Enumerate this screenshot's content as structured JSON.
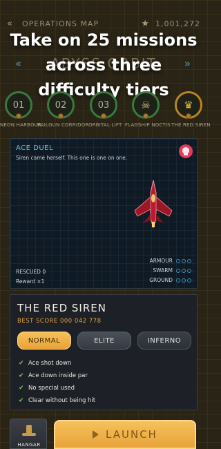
{
  "header": {
    "title": "OPERATIONS MAP",
    "score": "1,001,272",
    "region": "ABYSS ORBIT"
  },
  "promo": {
    "line1": "Take on 25 missions",
    "line2": "across three",
    "line3": "difficulty tiers"
  },
  "missions": [
    {
      "number": "01",
      "label": "NEON HARBOUR"
    },
    {
      "number": "02",
      "label": "RAILGUN CORRIDOR"
    },
    {
      "number": "03",
      "label": "ORBITAL LIFT"
    },
    {
      "number": "",
      "label": "FLAGSHIP NOCTIS",
      "icon": "skull-icon"
    },
    {
      "number": "",
      "label": "THE RED SIREN",
      "icon": "trophy-icon"
    }
  ],
  "mission_detail": {
    "name": "ACE DUEL",
    "description": "Siren came herself. This one is one on one.",
    "rescued": "RESCUED 0",
    "reward": "Reward ×1",
    "threats": [
      {
        "label": "ARMOUR",
        "level": 0,
        "max": 3
      },
      {
        "label": "SWARM",
        "level": 0,
        "max": 3
      },
      {
        "label": "GROUND",
        "level": 0,
        "max": 3
      }
    ]
  },
  "card": {
    "title": "THE RED SIREN",
    "best_score": "BEST SCORE  000 042 778",
    "difficulties": [
      "NORMAL",
      "ELITE",
      "INFERNO"
    ],
    "selected_difficulty": "NORMAL",
    "objectives": [
      "Ace shot down",
      "Ace down inside par",
      "No special used",
      "Clear without being hit"
    ]
  },
  "actions": {
    "hangar_label": "HANGAR",
    "launch_label": "LAUNCH"
  },
  "colors": {
    "accent_gold": "#f0b24a",
    "accent_cyan": "#5ec3e6",
    "check_green": "#6fcf5a",
    "boss_red": "#e63a5a"
  }
}
